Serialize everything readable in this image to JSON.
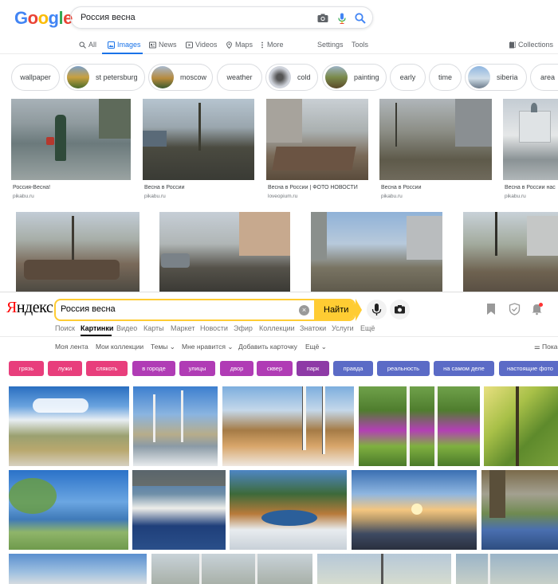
{
  "google": {
    "logo_letters": [
      "G",
      "o",
      "o",
      "g",
      "l",
      "e"
    ],
    "logo_colors": [
      "#4285f4",
      "#ea4335",
      "#fbbc05",
      "#4285f4",
      "#34a853",
      "#ea4335"
    ],
    "search_value": "Россия весна",
    "tabs": [
      {
        "label": "All",
        "icon": "search-icon"
      },
      {
        "label": "Images",
        "icon": "image-icon",
        "active": true
      },
      {
        "label": "News",
        "icon": "news-icon"
      },
      {
        "label": "Videos",
        "icon": "video-icon"
      },
      {
        "label": "Maps",
        "icon": "map-icon"
      },
      {
        "label": "More",
        "icon": "more-icon"
      }
    ],
    "settings": "Settings",
    "tools": "Tools",
    "collections": "Collections",
    "chips": [
      "wallpaper",
      "st petersburg",
      "moscow",
      "weather",
      "cold",
      "painting",
      "early",
      "time",
      "siberia",
      "area"
    ],
    "results": [
      {
        "caption": "Россия-Весна!",
        "source": "pikabu.ru"
      },
      {
        "caption": "Весна в России",
        "source": "pikabu.ru"
      },
      {
        "caption": "Весна в России | ФОТО НОВОСТИ",
        "source": "loveopium.ru"
      },
      {
        "caption": "Весна в России",
        "source": "pikabu.ru"
      },
      {
        "caption": "Весна в России нас",
        "source": "pikabu.ru"
      }
    ]
  },
  "yandex": {
    "logo": "Яндекс",
    "logo_first_color": "#f00",
    "search_value": "Россия весна",
    "search_button": "Найти",
    "nav": [
      "Поиск",
      "Картинки",
      "Видео",
      "Карты",
      "Маркет",
      "Новости",
      "Эфир",
      "Коллекции",
      "Знатоки",
      "Услуги",
      "Ещё"
    ],
    "active_nav": "Картинки",
    "subnav": [
      "Моя лента",
      "Мои коллекции",
      "Темы",
      "Мне нравится",
      "Добавить карточку",
      "Ещё"
    ],
    "subnav_right": "Пока",
    "tags": [
      {
        "label": "грязь",
        "color": "#e83e7c"
      },
      {
        "label": "лужи",
        "color": "#e83e7c"
      },
      {
        "label": "слякоть",
        "color": "#e83e7c"
      },
      {
        "label": "в городе",
        "color": "#b03cb5"
      },
      {
        "label": "улицы",
        "color": "#b03cb5"
      },
      {
        "label": "двор",
        "color": "#b03cb5"
      },
      {
        "label": "сквер",
        "color": "#b03cb5"
      },
      {
        "label": "парк",
        "color": "#8e3aa6"
      },
      {
        "label": "правда",
        "color": "#5b6bc6"
      },
      {
        "label": "реальность",
        "color": "#5b6bc6"
      },
      {
        "label": "на самом деле",
        "color": "#5b6bc6"
      },
      {
        "label": "настоящие фото",
        "color": "#5b6bc6"
      }
    ]
  }
}
